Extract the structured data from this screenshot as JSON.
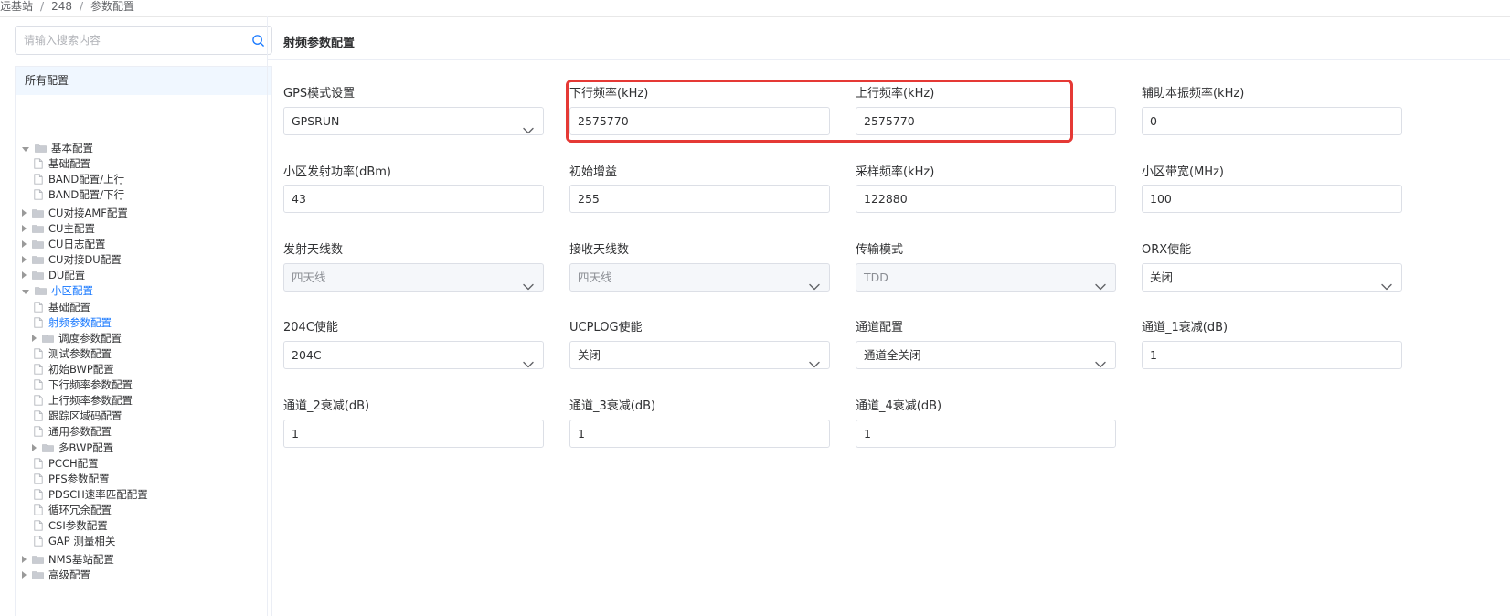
{
  "breadcrumb": [
    "远基站",
    "248",
    "参数配置"
  ],
  "search": {
    "placeholder": "请输入搜索内容"
  },
  "tree": {
    "header": "所有配置",
    "nodes": [
      "基本配置",
      "基础配置",
      "BAND配置/上行",
      "BAND配置/下行",
      "CU对接AMF配置",
      "CU主配置",
      "CU日志配置",
      "CU对接DU配置",
      "DU配置",
      "小区配置",
      "基础配置",
      "射频参数配置",
      "调度参数配置",
      "测试参数配置",
      "初始BWP配置",
      "下行频率参数配置",
      "上行频率参数配置",
      "跟踪区域码配置",
      "通用参数配置",
      "多BWP配置",
      "PCCH配置",
      "PFS参数配置",
      "PDSCH速率匹配配置",
      "循环冗余配置",
      "CSI参数配置",
      "GAP 测量相关",
      "NMS基站配置",
      "高级配置"
    ]
  },
  "main": {
    "title": "射频参数配置",
    "fields": [
      {
        "label": "GPS模式设置",
        "value": "GPSRUN",
        "type": "select"
      },
      {
        "label": "下行频率(kHz)",
        "value": "2575770",
        "type": "input"
      },
      {
        "label": "上行频率(kHz)",
        "value": "2575770",
        "type": "input"
      },
      {
        "label": "辅助本振频率(kHz)",
        "value": "0",
        "type": "input"
      },
      {
        "label": "小区发射功率(dBm)",
        "value": "43",
        "type": "input"
      },
      {
        "label": "初始增益",
        "value": "255",
        "type": "input"
      },
      {
        "label": "采样频率(kHz)",
        "value": "122880",
        "type": "input"
      },
      {
        "label": "小区带宽(MHz)",
        "value": "100",
        "type": "input"
      },
      {
        "label": "发射天线数",
        "value": "四天线",
        "type": "select",
        "disabled": true
      },
      {
        "label": "接收天线数",
        "value": "四天线",
        "type": "select",
        "disabled": true
      },
      {
        "label": "传输模式",
        "value": "TDD",
        "type": "select",
        "disabled": true
      },
      {
        "label": "ORX使能",
        "value": "关闭",
        "type": "select"
      },
      {
        "label": "204C使能",
        "value": "204C",
        "type": "select"
      },
      {
        "label": "UCPLOG使能",
        "value": "关闭",
        "type": "select"
      },
      {
        "label": "通道配置",
        "value": "通道全关闭",
        "type": "select"
      },
      {
        "label": "通道_1衰减(dB)",
        "value": "1",
        "type": "input"
      },
      {
        "label": "通道_2衰减(dB)",
        "value": "1",
        "type": "input"
      },
      {
        "label": "通道_3衰减(dB)",
        "value": "1",
        "type": "input"
      },
      {
        "label": "通道_4衰减(dB)",
        "value": "1",
        "type": "input"
      }
    ]
  },
  "colors": {
    "accent": "#1677ff",
    "highlight": "#e53935"
  }
}
